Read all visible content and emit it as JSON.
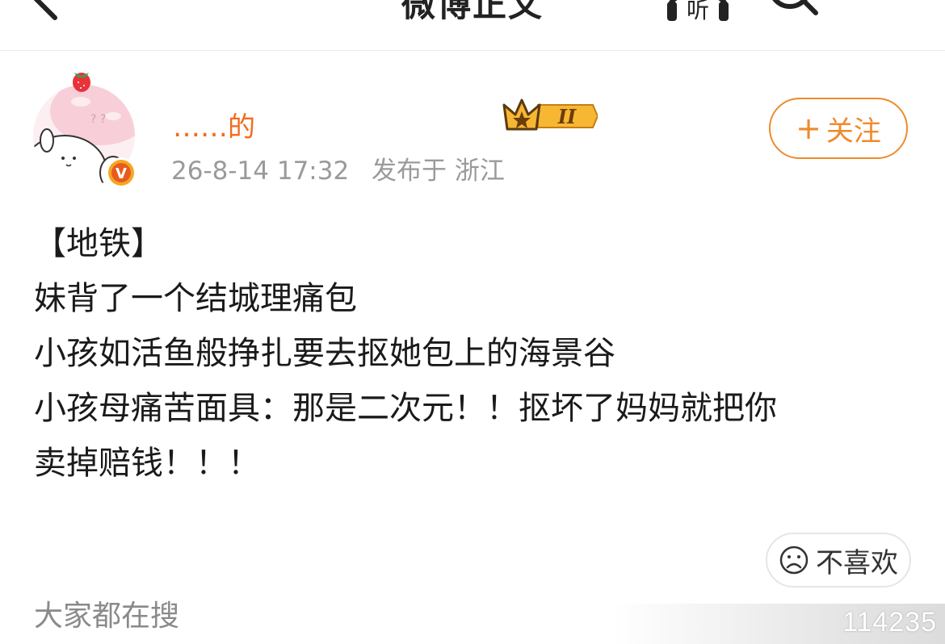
{
  "nav": {
    "title": "微博正文",
    "back_icon": "chevron-left-icon",
    "listen_icon": "headphones-icon",
    "search_icon": "search-icon",
    "more_icon": "more-icon"
  },
  "author": {
    "name_visible": "……的",
    "level_badge": "II",
    "verified_mark": "V",
    "timestamp": "26-8-14 17:32",
    "location": "发布于 浙江",
    "name_color": "#f26b1c"
  },
  "follow_button": {
    "plus": "+",
    "label": "关注",
    "color": "#f08a2c"
  },
  "post": {
    "lines": [
      "【地铁】",
      "妹背了一个结城理痛包",
      "小孩如活鱼般挣扎要去抠她包上的海景谷",
      "小孩母痛苦面具：那是二次元！！抠坏了妈妈就把你",
      "卖掉赔钱！！！"
    ]
  },
  "dislike_button": {
    "label": "不喜欢",
    "icon": "frown-face-icon"
  },
  "bottom": {
    "everyone_search": "大家都在搜",
    "watermark_number": "114235"
  }
}
